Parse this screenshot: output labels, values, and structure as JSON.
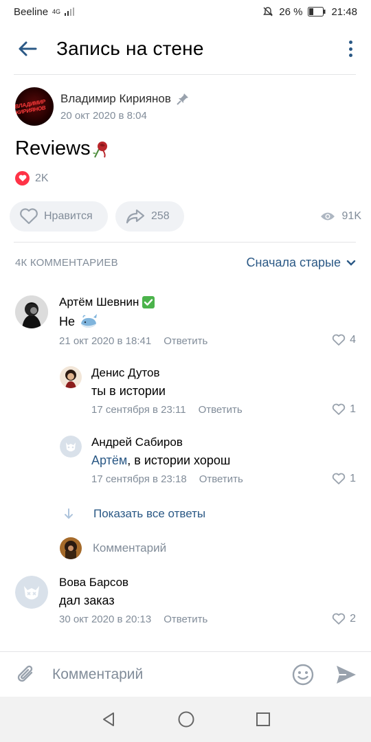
{
  "status": {
    "carrier": "Beeline",
    "net": "4G",
    "battery": "26 %",
    "time": "21:48"
  },
  "header": {
    "title": "Запись на стене"
  },
  "post": {
    "author": "Владимир Кириянов",
    "date": "20 окт 2020 в 8:04",
    "avatar_text": "ВЛАДИМИР КИРИЯНОВ",
    "text": "Reviews",
    "reactions_count": "2K",
    "like_label": "Нравится",
    "shares": "258",
    "views": "91K"
  },
  "comments_header": {
    "count": "4К КОММЕНТАРИЕВ",
    "sort": "Сначала старые"
  },
  "comments": [
    {
      "name": "Артём Шевнин",
      "text": "Не",
      "date": "21 окт 2020 в 18:41",
      "reply": "Ответить",
      "likes": "4"
    },
    {
      "name": "Денис Дутов",
      "text": "ты в истории",
      "date": "17 сентября в 23:11",
      "reply": "Ответить",
      "likes": "1"
    },
    {
      "name": "Андрей Сабиров",
      "mention": "Артём",
      "text": ", в истории хорош",
      "date": "17 сентября в 23:18",
      "reply": "Ответить",
      "likes": "1"
    },
    {
      "name": "Вова Барсов",
      "text": "дал заказ",
      "date": "30 окт 2020 в 20:13",
      "reply": "Ответить",
      "likes": "2"
    }
  ],
  "show_all_replies": "Показать все ответы",
  "reply_placeholder": "Комментарий",
  "bottom": {
    "placeholder": "Комментарий"
  },
  "colors": {
    "accent": "#2a5885",
    "secondary": "#818c99",
    "heart": "#ff3347",
    "verified": "#4bb34b"
  }
}
